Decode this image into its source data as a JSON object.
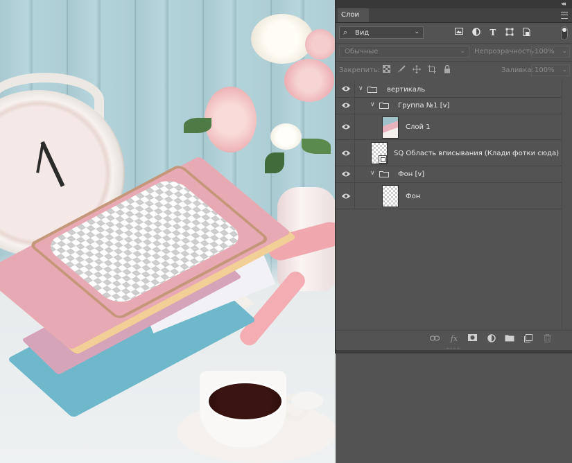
{
  "panel": {
    "tab_title": "Слои",
    "collapse_glyph": "◂◂",
    "filter": {
      "search_glyph": "⌕",
      "value": "Вид",
      "buttons": [
        "pixel-layer-filter-icon",
        "adjustment-filter-icon",
        "type-filter-icon",
        "shape-filter-icon",
        "smart-object-filter-icon"
      ]
    },
    "blend_mode": "Обычные",
    "opacity_label": "Непрозрачность:",
    "opacity_value": "100%",
    "lock_label": "Закрепить:",
    "fill_label": "Заливка:",
    "fill_value": "100%",
    "layers": [
      {
        "name": "вертикаль",
        "type": "group",
        "visible": true,
        "indent": 0,
        "expanded": true
      },
      {
        "name": "Группа №1 [v]",
        "type": "group",
        "visible": true,
        "indent": 1,
        "expanded": true
      },
      {
        "name": "Слой 1",
        "type": "pixel",
        "visible": true,
        "indent": 2
      },
      {
        "name": "SQ Область вписывания (Клади фотки сюда) ...",
        "type": "smart-object",
        "visible": true,
        "indent": 1
      },
      {
        "name": "Фон [v]",
        "type": "group",
        "visible": true,
        "indent": 1,
        "expanded": true
      },
      {
        "name": "Фон",
        "type": "pixel",
        "visible": true,
        "indent": 2
      }
    ],
    "bottom_buttons": [
      "link-layers-icon",
      "fx-icon",
      "add-mask-icon",
      "adjustment-layer-icon",
      "new-group-icon",
      "new-layer-icon",
      "delete-layer-icon"
    ]
  },
  "colors": {
    "panel_bg": "#535353",
    "tab_bar": "#424242",
    "text": "#e8e8e8",
    "disabled_text": "#8c8c8c"
  }
}
